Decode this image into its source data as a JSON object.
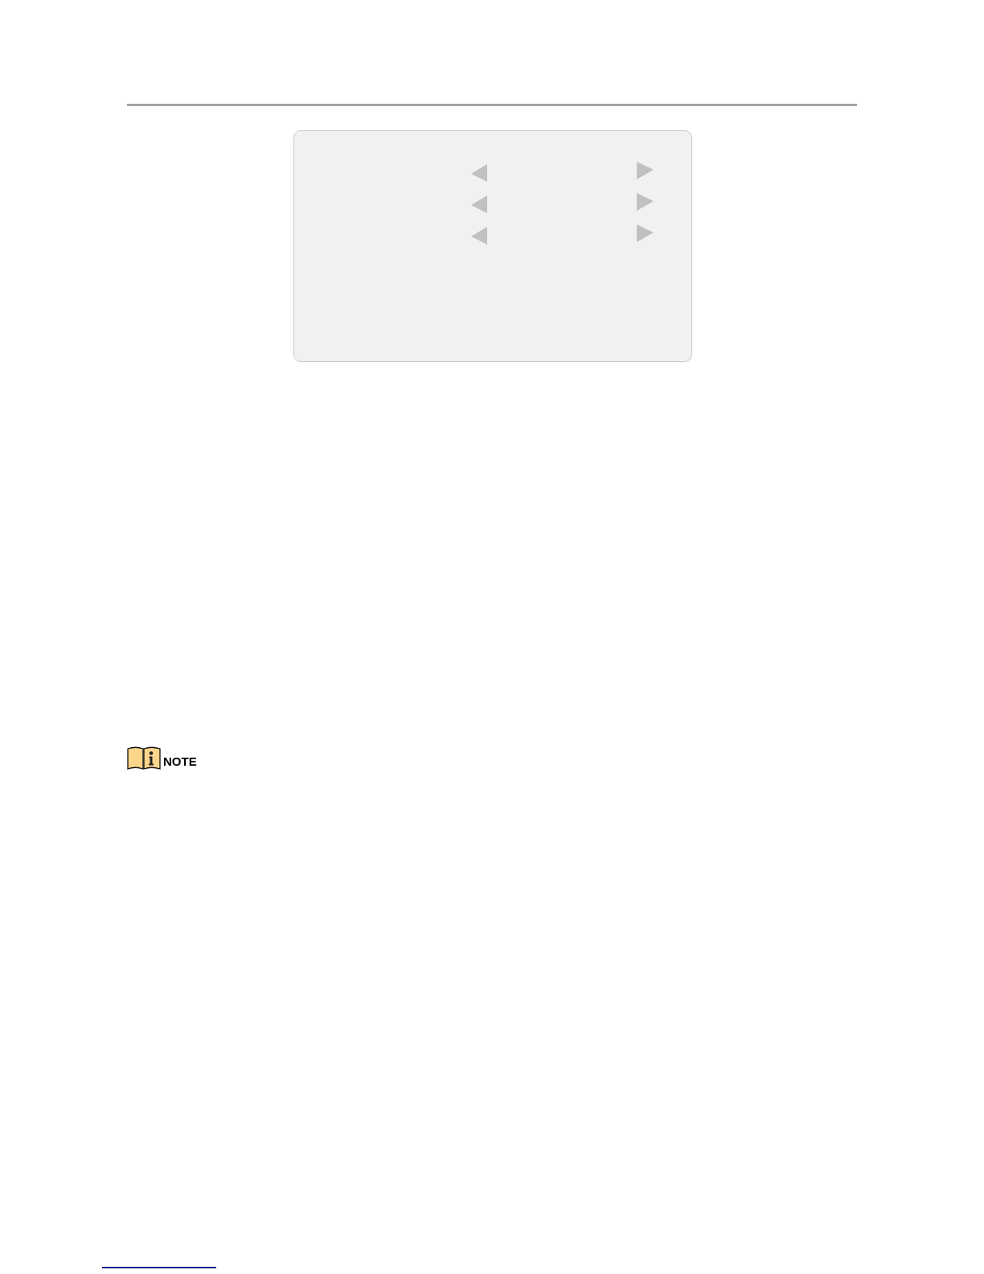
{
  "note": {
    "heading": "NOTE"
  }
}
